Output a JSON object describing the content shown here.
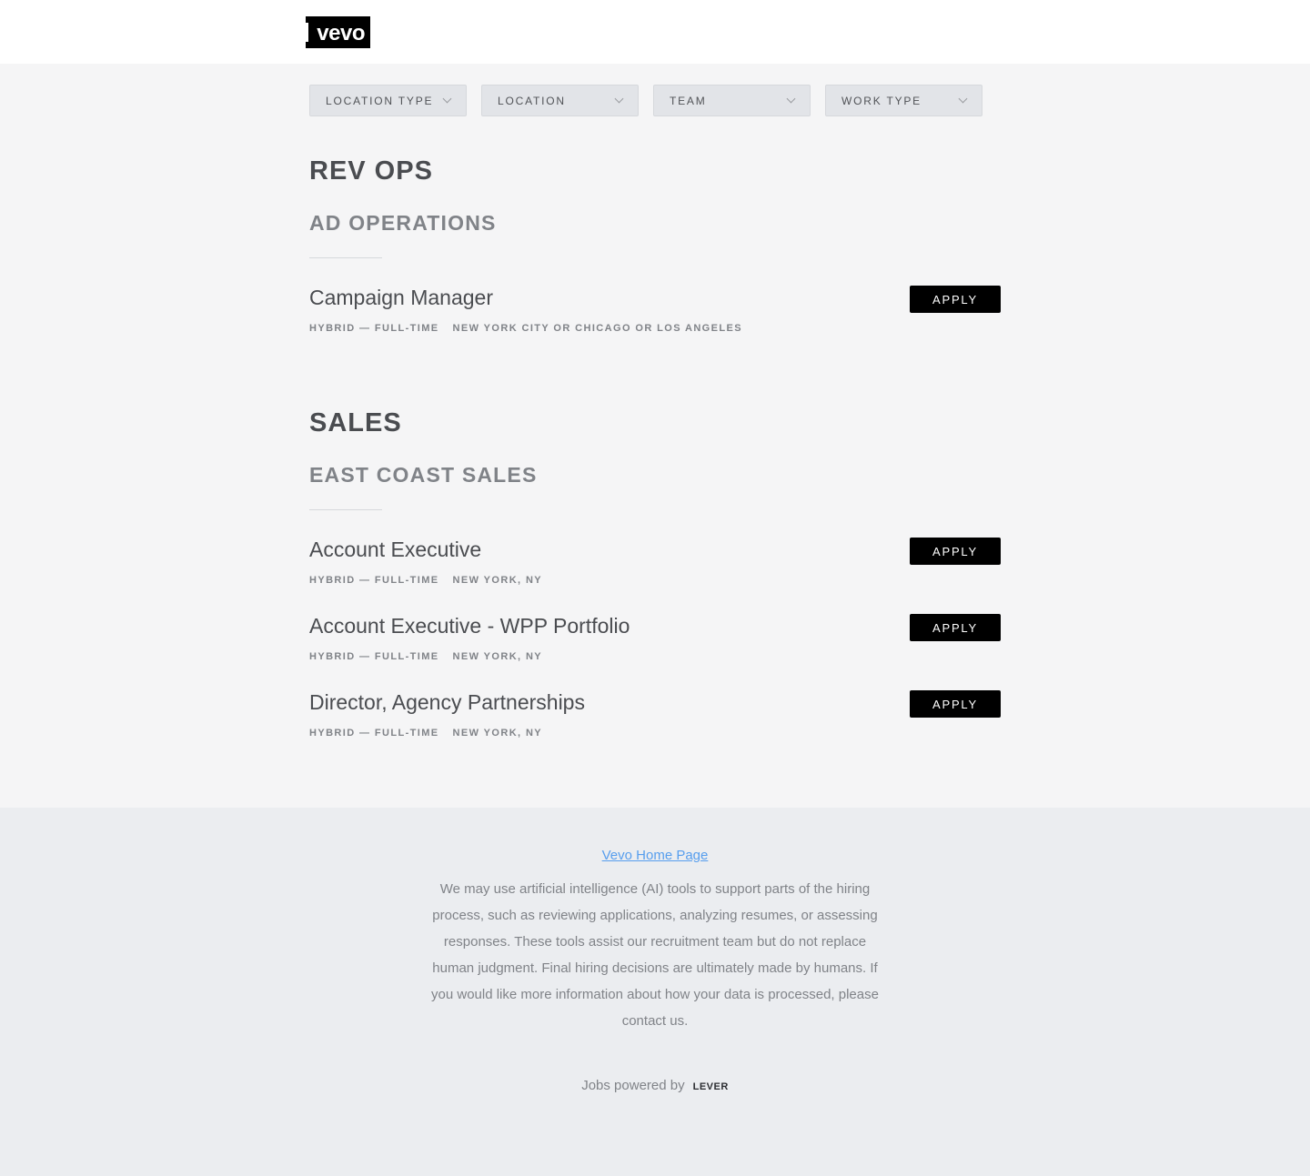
{
  "header": {
    "logo_text": "vevo"
  },
  "filters": [
    {
      "label": "LOCATION TYPE"
    },
    {
      "label": "LOCATION"
    },
    {
      "label": "TEAM"
    },
    {
      "label": "WORK TYPE"
    }
  ],
  "groups": [
    {
      "title": "REV OPS",
      "subgroup": "AD OPERATIONS",
      "postings": [
        {
          "title": "Campaign Manager",
          "work": "HYBRID — FULL-TIME",
          "location": "NEW YORK CITY OR CHICAGO OR LOS ANGELES",
          "apply_label": "APPLY"
        }
      ]
    },
    {
      "title": "SALES",
      "subgroup": "EAST COAST SALES",
      "postings": [
        {
          "title": "Account Executive",
          "work": "HYBRID — FULL-TIME",
          "location": "NEW YORK, NY",
          "apply_label": "APPLY"
        },
        {
          "title": "Account Executive - WPP Portfolio",
          "work": "HYBRID — FULL-TIME",
          "location": "NEW YORK, NY",
          "apply_label": "APPLY"
        },
        {
          "title": "Director, Agency Partnerships",
          "work": "HYBRID — FULL-TIME",
          "location": "NEW YORK, NY",
          "apply_label": "APPLY"
        }
      ]
    }
  ],
  "footer": {
    "home_link": "Vevo Home Page",
    "ai_notice": "We may use artificial intelligence (AI) tools to support parts of the hiring process, such as reviewing applications, analyzing resumes, or assessing responses. These tools assist our recruitment team but do not replace human judgment. Final hiring decisions are ultimately made by humans. If you would like more information about how your data is processed, please contact us.",
    "powered_by": "Jobs powered by",
    "lever_logo_text": "LEVER"
  }
}
